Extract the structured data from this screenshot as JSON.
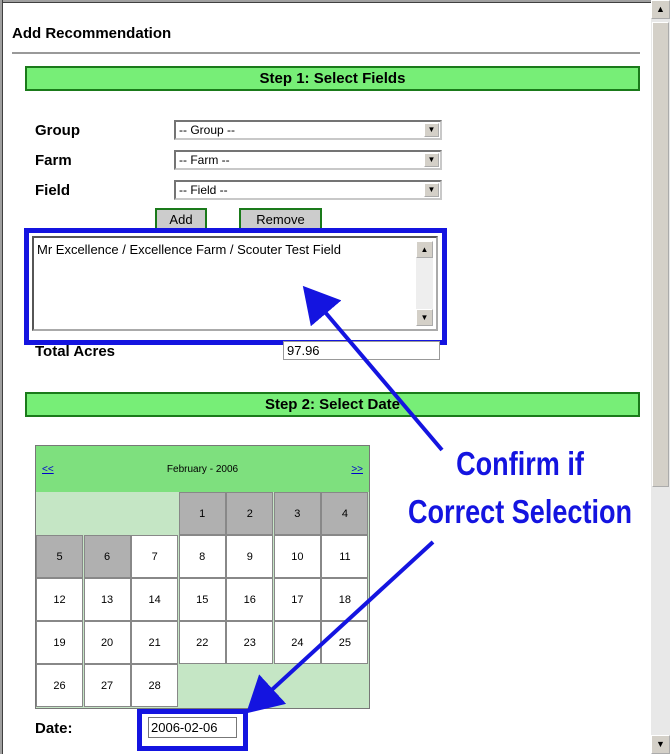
{
  "header": {
    "title": "Add Recommendation"
  },
  "step1": {
    "title": "Step 1: Select Fields"
  },
  "form": {
    "group_label": "Group",
    "group_value": "-- Group --",
    "farm_label": "Farm",
    "farm_value": "-- Farm --",
    "field_label": "Field",
    "field_value": "-- Field --",
    "add_label": "Add",
    "remove_label": "Remove",
    "selected_fields": [
      "Mr Excellence / Excellence Farm / Scouter Test Field"
    ],
    "total_acres_label": "Total Acres",
    "total_acres_value": "97.96"
  },
  "step2": {
    "title": "Step 2: Select Date"
  },
  "calendar": {
    "prev": "<<",
    "next": ">>",
    "month_title": "February - 2006",
    "weeks": [
      [
        "",
        "",
        "",
        "1",
        "2",
        "3",
        "4"
      ],
      [
        "5",
        "6",
        "7",
        "8",
        "9",
        "10",
        "11"
      ],
      [
        "12",
        "13",
        "14",
        "15",
        "16",
        "17",
        "18"
      ],
      [
        "19",
        "20",
        "21",
        "22",
        "23",
        "24",
        "25"
      ],
      [
        "26",
        "27",
        "28",
        "",
        "",
        "",
        ""
      ]
    ],
    "greyed_days": [
      "1",
      "2",
      "3",
      "4",
      "5",
      "6"
    ]
  },
  "date": {
    "label": "Date:",
    "value": "2006-02-06"
  },
  "annotation": {
    "line1": "Confirm if",
    "line2": "Correct Selection"
  },
  "colors": {
    "step_bar": "#77ee77",
    "highlight": "#1414e0",
    "calendar_header": "#7ee07e"
  }
}
